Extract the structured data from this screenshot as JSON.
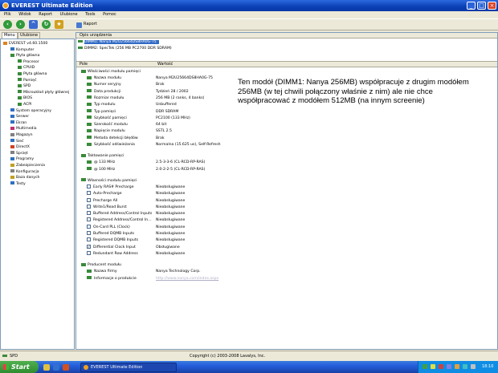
{
  "window": {
    "title": "EVEREST Ultimate Edition"
  },
  "menu": [
    "Plik",
    "Widok",
    "Raport",
    "Ulubione",
    "Tools",
    "Pomoc"
  ],
  "toolbar": {
    "report_label": "Raport"
  },
  "tabs": {
    "menu": "Menu",
    "favorites": "Ulubione"
  },
  "tree": [
    {
      "label": "EVEREST v4.60.1500",
      "level": 0,
      "color": "#e08020"
    },
    {
      "label": "Komputer",
      "level": 1,
      "color": "#3070c0"
    },
    {
      "label": "Płyta główna",
      "level": 1,
      "color": "#3a8a3a"
    },
    {
      "label": "Procesor",
      "level": 2,
      "color": "#3a8a3a"
    },
    {
      "label": "CPUID",
      "level": 2,
      "color": "#3a8a3a"
    },
    {
      "label": "Płyta główna",
      "level": 2,
      "color": "#3a8a3a"
    },
    {
      "label": "Pamięć",
      "level": 2,
      "color": "#3a8a3a"
    },
    {
      "label": "SPD",
      "level": 2,
      "color": "#3a8a3a"
    },
    {
      "label": "Mikroukład płyty głównej",
      "level": 2,
      "color": "#3a8a3a"
    },
    {
      "label": "BIOS",
      "level": 2,
      "color": "#3a8a3a"
    },
    {
      "label": "ACPI",
      "level": 2,
      "color": "#3a8a3a"
    },
    {
      "label": "System operacyjny",
      "level": 1,
      "color": "#3070c0"
    },
    {
      "label": "Serwer",
      "level": 1,
      "color": "#3070c0"
    },
    {
      "label": "Ekran",
      "level": 1,
      "color": "#3070c0"
    },
    {
      "label": "Multimedia",
      "level": 1,
      "color": "#c03070"
    },
    {
      "label": "Magazyn",
      "level": 1,
      "color": "#808080"
    },
    {
      "label": "Sieć",
      "level": 1,
      "color": "#3070c0"
    },
    {
      "label": "DirectX",
      "level": 1,
      "color": "#d04020"
    },
    {
      "label": "Sprzęt",
      "level": 1,
      "color": "#808080"
    },
    {
      "label": "Programy",
      "level": 1,
      "color": "#3070c0"
    },
    {
      "label": "Zabezpieczenia",
      "level": 1,
      "color": "#c0a020"
    },
    {
      "label": "Konfiguracja",
      "level": 1,
      "color": "#808080"
    },
    {
      "label": "Baza danych",
      "level": 1,
      "color": "#c0a020"
    },
    {
      "label": "Testy",
      "level": 1,
      "color": "#3070c0"
    }
  ],
  "device_header": "Opis urządzenia",
  "devices": [
    {
      "label": "DIMM1: Nanya M2U25664DS8HA0G-75",
      "selected": true
    },
    {
      "label": "DIMM2: SpecTek (256 MB PC2700 DDR SDRAM)",
      "selected": false
    }
  ],
  "columns": {
    "field": "Pole",
    "value": "Wartość"
  },
  "sections": {
    "props": "Właściwości modułu pamięci",
    "timing": "Taktowanie pamięci",
    "features": "Własności modułu pamięci",
    "vendor": "Producent modułu"
  },
  "props": [
    {
      "field": "Nazwa modułu",
      "value": "Nanya M2U25664DS8HA0G-75"
    },
    {
      "field": "Numer seryjny",
      "value": "Brak"
    },
    {
      "field": "Data produkcji",
      "value": "Tydzień 28 / 2002"
    },
    {
      "field": "Rozmiar modułu",
      "value": "256 MB (2 ranks, 4 banks)"
    },
    {
      "field": "Typ modułu",
      "value": "Unbuffered"
    },
    {
      "field": "Typ pamięci",
      "value": "DDR SDRAM"
    },
    {
      "field": "Szybkość pamięci",
      "value": "PC2100 (133 MHz)"
    },
    {
      "field": "Szerokość modułu",
      "value": "64 bit"
    },
    {
      "field": "Napięcie modułu",
      "value": "SSTL 2.5"
    },
    {
      "field": "Metoda detekcji błędów",
      "value": "Brak"
    },
    {
      "field": "Szybkość odświeżania",
      "value": "Normalna (15.625 us), Self-Refresh"
    }
  ],
  "timing": [
    {
      "field": "@ 133 MHz",
      "value": "2.5-3-3-6  (CL-RCD-RP-RAS)"
    },
    {
      "field": "@ 100 MHz",
      "value": "2.0-2-2-5  (CL-RCD-RP-RAS)"
    }
  ],
  "features": [
    {
      "field": "Early RAS# Precharge",
      "value": "Nieobsługiwane",
      "checked": false
    },
    {
      "field": "Auto-Precharge",
      "value": "Nieobsługiwane",
      "checked": false
    },
    {
      "field": "Precharge All",
      "value": "Nieobsługiwane",
      "checked": false
    },
    {
      "field": "Write1/Read Burst",
      "value": "Nieobsługiwane",
      "checked": false
    },
    {
      "field": "Buffered Address/Control Inputs",
      "value": "Nieobsługiwane",
      "checked": false
    },
    {
      "field": "Registered Address/Control In...",
      "value": "Nieobsługiwane",
      "checked": false
    },
    {
      "field": "On-Card PLL (Clock)",
      "value": "Nieobsługiwane",
      "checked": false
    },
    {
      "field": "Buffered DQMB Inputs",
      "value": "Nieobsługiwane",
      "checked": false
    },
    {
      "field": "Registered DQMB Inputs",
      "value": "Nieobsługiwane",
      "checked": false
    },
    {
      "field": "Differential Clock Input",
      "value": "Obsługiwane",
      "checked": true
    },
    {
      "field": "Redundant Row Address",
      "value": "Nieobsługiwane",
      "checked": false
    }
  ],
  "vendor": [
    {
      "field": "Nazwa firmy",
      "value": "Nanya Technology Corp."
    },
    {
      "field": "Informacje o produkcie",
      "value": "http://www.nanya.com/index.aspx"
    }
  ],
  "annotation": "Ten modół (DIMM1: Nanya 256MB) współpracuje z drugim modółem 256MB (w tej chwili połączony właśnie z nim) ale nie chce współpracować z modółem 512MB (na innym screenie)",
  "status": {
    "left": "SPD",
    "copyright": "Copyright (c) 2003-2008 Lavalys, Inc."
  },
  "taskbar": {
    "start": "Start",
    "task": "EVEREST Ultimate Edition",
    "clock": "18:10"
  }
}
